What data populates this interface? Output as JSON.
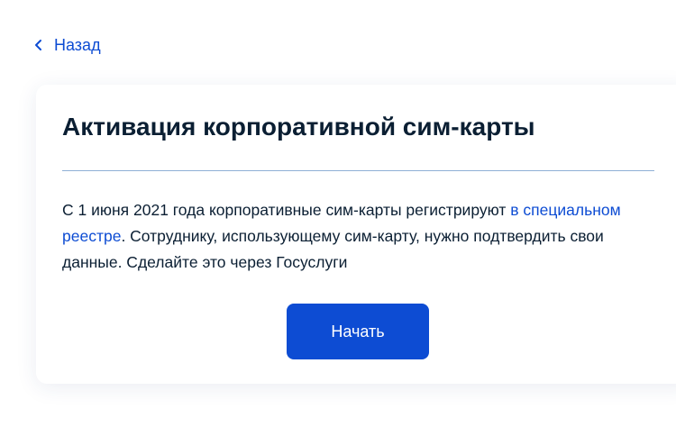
{
  "back": {
    "label": "Назад",
    "icon": "chevron-left-icon"
  },
  "card": {
    "title": "Активация корпоративной сим-карты",
    "description": {
      "part1": "С 1 июня 2021 года корпоративные сим-карты регистрируют ",
      "link": "в специальном реестре",
      "part2": ". Сотруднику, использующему сим-карту, нужно подтвердить свои данные. Сделайте это через Госуслуги"
    },
    "start_button": "Начать"
  },
  "colors": {
    "accent": "#0d4cd3",
    "text": "#0b1f33",
    "divider": "#8fb0d6"
  }
}
